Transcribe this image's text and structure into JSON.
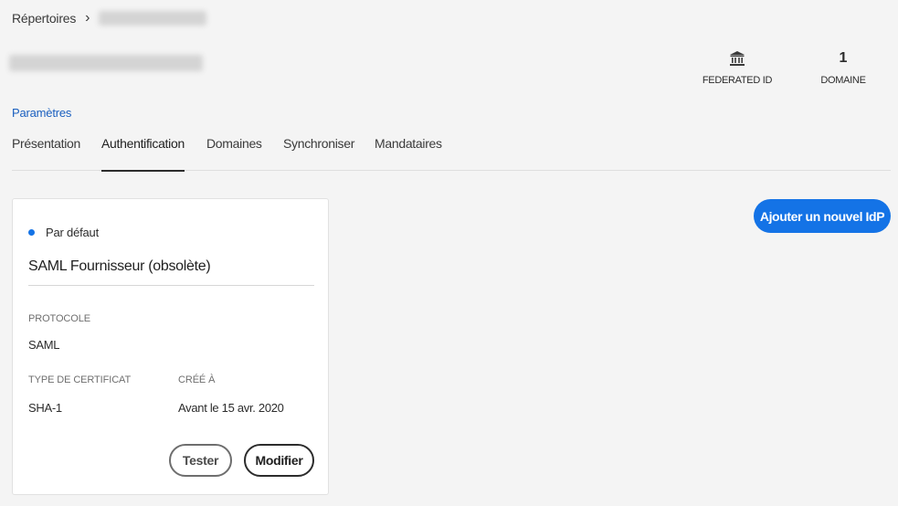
{
  "breadcrumb": {
    "root": "Répertoires",
    "separator": "›"
  },
  "stats": {
    "federated_label": "FEDERATED ID",
    "federated_icon": "bank-icon",
    "domain_count": "1",
    "domain_label": "DOMAINE"
  },
  "settings_link": "Paramètres",
  "tabs": [
    {
      "label": "Présentation",
      "active": false
    },
    {
      "label": "Authentification",
      "active": true
    },
    {
      "label": "Domaines",
      "active": false
    },
    {
      "label": "Synchroniser",
      "active": false
    },
    {
      "label": "Mandataires",
      "active": false
    }
  ],
  "add_idp_button": "Ajouter un nouvel IdP",
  "card": {
    "default_label": "Par défaut",
    "title": "SAML Fournisseur (obsolète)",
    "protocol_label": "PROTOCOLE",
    "protocol_value": "SAML",
    "cert_type_label": "TYPE DE CERTIFICAT",
    "cert_type_value": "SHA-1",
    "created_label": "CRÉÉ À",
    "created_value": "Avant le 15 avr. 2020",
    "test_button": "Tester",
    "edit_button": "Modifier"
  },
  "colors": {
    "accent": "#1473e6",
    "link": "#1a5fbf",
    "background": "#f4f4f4"
  }
}
